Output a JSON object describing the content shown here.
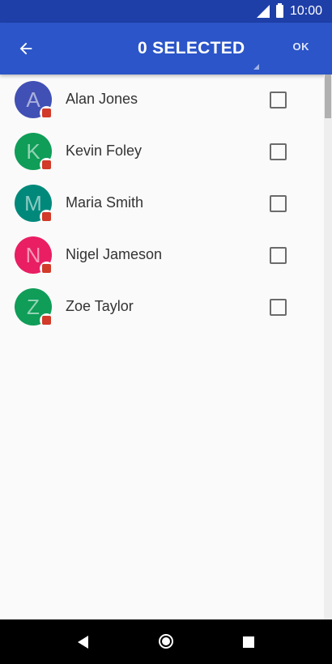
{
  "status_bar": {
    "time": "10:00",
    "icons": [
      "signal-icon",
      "battery-icon"
    ]
  },
  "app_bar": {
    "back_icon": "arrow-back-icon",
    "title": "0 SELECTED",
    "ok_label": "OK"
  },
  "contacts": [
    {
      "initial": "A",
      "name": "Alan Jones",
      "avatar_color": "#4150b4",
      "checked": false
    },
    {
      "initial": "K",
      "name": "Kevin Foley",
      "avatar_color": "#0f9d58",
      "checked": false
    },
    {
      "initial": "M",
      "name": "Maria Smith",
      "avatar_color": "#00897b",
      "checked": false
    },
    {
      "initial": "N",
      "name": "Nigel Jameson",
      "avatar_color": "#e91e63",
      "checked": false
    },
    {
      "initial": "Z",
      "name": "Zoe Taylor",
      "avatar_color": "#0f9d58",
      "checked": false
    }
  ],
  "nav_bar": {
    "icons": [
      "nav-back-icon",
      "nav-home-icon",
      "nav-recents-icon"
    ]
  },
  "colors": {
    "status_bar": "#1f3fa8",
    "app_bar": "#2b55c8",
    "badge": "#d23a2a"
  }
}
